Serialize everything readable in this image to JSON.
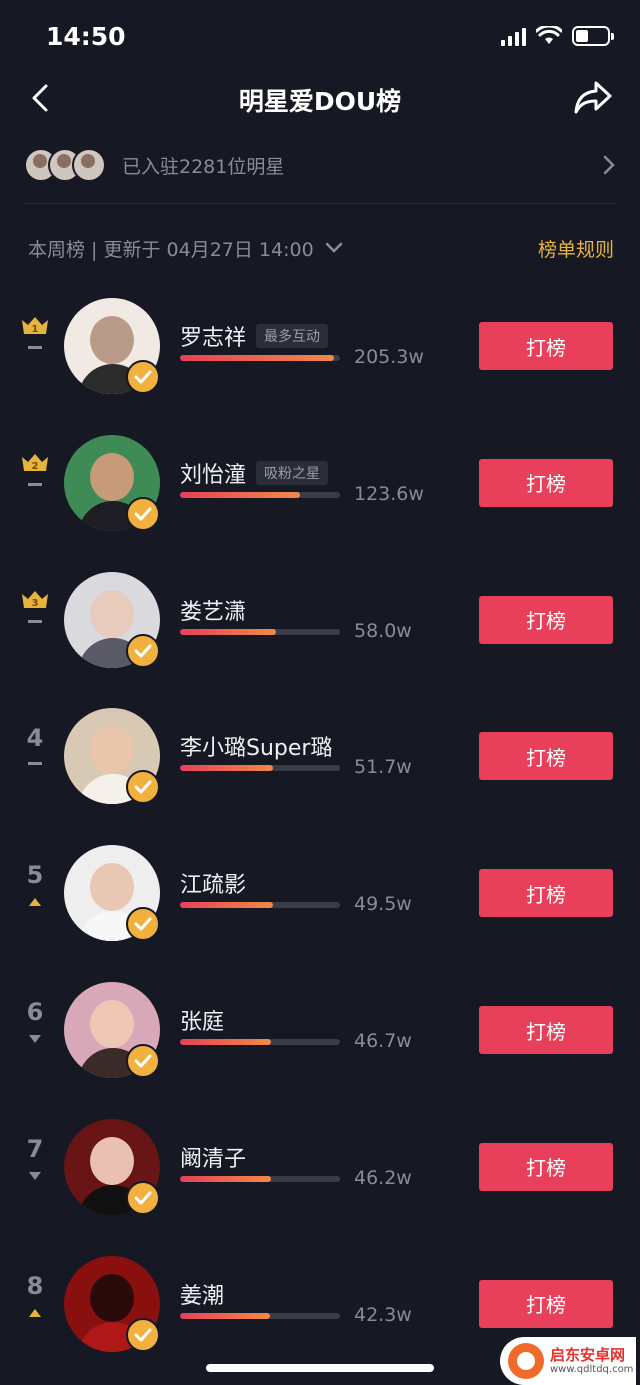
{
  "status": {
    "time": "14:50"
  },
  "nav": {
    "title": "明星爱DOU榜"
  },
  "joined": {
    "text": "已入驻2281位明星"
  },
  "update": {
    "text": "本周榜 | 更新于 04月27日 14:00",
    "rules": "榜单规则"
  },
  "vote_label": "打榜",
  "colors": {
    "background": "#161823",
    "accent": "#e8405a",
    "gold": "#e6b43c",
    "badge": "#f2b13f"
  },
  "stars": [
    {
      "rank": "1",
      "crown": true,
      "trend": "same",
      "name": "罗志祥",
      "tag": "最多互动",
      "score": "205.3w",
      "progress": 0.96
    },
    {
      "rank": "2",
      "crown": true,
      "trend": "same",
      "name": "刘怡潼",
      "tag": "吸粉之星",
      "score": "123.6w",
      "progress": 0.75
    },
    {
      "rank": "3",
      "crown": true,
      "trend": "same",
      "name": "娄艺潇",
      "tag": "",
      "score": "58.0w",
      "progress": 0.6
    },
    {
      "rank": "4",
      "crown": false,
      "trend": "same",
      "name": "李小璐Super璐",
      "tag": "",
      "score": "51.7w",
      "progress": 0.58
    },
    {
      "rank": "5",
      "crown": false,
      "trend": "up",
      "name": "江疏影",
      "tag": "",
      "score": "49.5w",
      "progress": 0.58
    },
    {
      "rank": "6",
      "crown": false,
      "trend": "down",
      "name": "张庭",
      "tag": "",
      "score": "46.7w",
      "progress": 0.57
    },
    {
      "rank": "7",
      "crown": false,
      "trend": "down",
      "name": "阚清子",
      "tag": "",
      "score": "46.2w",
      "progress": 0.57
    },
    {
      "rank": "8",
      "crown": false,
      "trend": "up",
      "name": "姜潮",
      "tag": "",
      "score": "42.3w",
      "progress": 0.56
    }
  ],
  "watermark": {
    "main": "启东安卓网",
    "sub": "www.qdltdq.com"
  }
}
